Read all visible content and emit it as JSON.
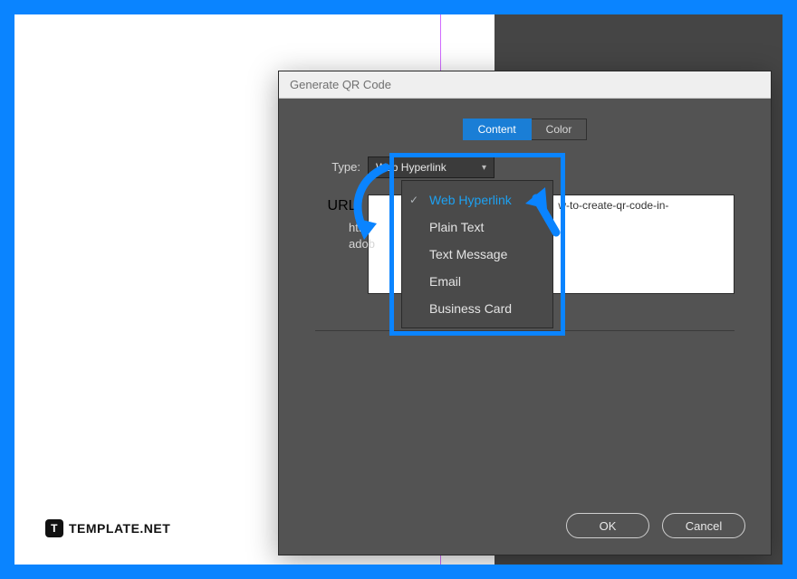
{
  "dialog": {
    "title": "Generate QR Code",
    "tabs": {
      "content": "Content",
      "color": "Color"
    },
    "labels": {
      "type": "Type:",
      "url": "URL:"
    },
    "type_select": {
      "value": "Web Hyperlink"
    },
    "url_value_visible_right": "w-to-create-qr-code-in-",
    "url_fragment_left_top": "http",
    "url_fragment_left_bottom": "adob",
    "dropdown_items": [
      "Web Hyperlink",
      "Plain Text",
      "Text Message",
      "Email",
      "Business Card"
    ],
    "dropdown_selected_index": 0,
    "buttons": {
      "ok": "OK",
      "cancel": "Cancel"
    }
  },
  "watermark": {
    "icon_text": "T",
    "label": "TEMPLATE.NET"
  }
}
